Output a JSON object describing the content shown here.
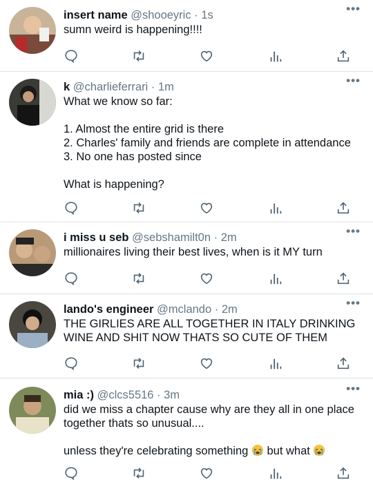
{
  "tweets": [
    {
      "name": "insert name",
      "handle": "@shooeyric",
      "dot": "·",
      "time": "1s",
      "lines": [
        "sumn weird is happening!!!!"
      ]
    },
    {
      "name": "k",
      "handle": "@charlieferrari",
      "dot": "·",
      "time": "1m",
      "lines": [
        "What we know so far:",
        "",
        "1. Almost the entire grid is there",
        "2. Charles' family and friends are complete in attendance",
        "3. No one has posted since",
        "",
        "What is happening?"
      ]
    },
    {
      "name": "i miss u seb",
      "handle": "@sebshamilt0n",
      "dot": "·",
      "time": "2m",
      "lines": [
        "millionaires living their best lives, when is it MY turn"
      ]
    },
    {
      "name": "lando's engineer",
      "handle": "@mclando",
      "dot": "·",
      "time": "2m",
      "lines": [
        "THE GIRLIES ARE ALL TOGETHER IN ITALY DRINKING",
        "WINE AND SHIT NOW THATS SO CUTE OF THEM"
      ]
    },
    {
      "name": "mia :)",
      "handle": "@clcs5516",
      "dot": "·",
      "time": "3m",
      "lines": [
        "did we miss a chapter cause why are they all in one place",
        "together thats so unusual....",
        ""
      ],
      "last_line_a": "unless they're celebrating something",
      "last_line_b": "but what",
      "emoji": "loudly-crying-face"
    }
  ],
  "more_label": "•••",
  "icons": {
    "reply": "reply-icon",
    "retweet": "retweet-icon",
    "like": "heart-icon",
    "analytics": "analytics-icon",
    "share": "share-icon"
  },
  "colors": {
    "text": "#0f1419",
    "secondary": "#657786",
    "divider": "#dfe3e6"
  }
}
